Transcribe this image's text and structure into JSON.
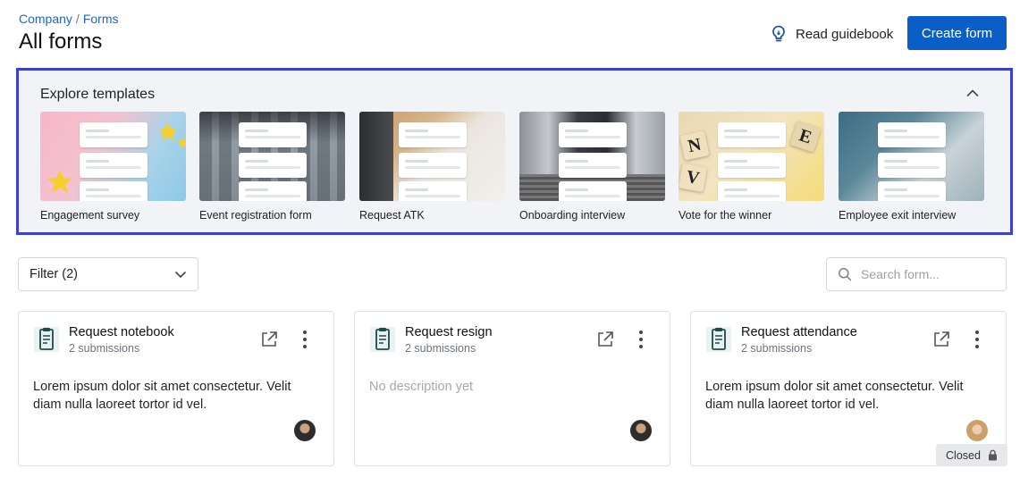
{
  "breadcrumb": {
    "items": [
      "Company",
      "Forms"
    ]
  },
  "header": {
    "title": "All forms",
    "guide_label": "Read guidebook",
    "create_label": "Create form"
  },
  "templates": {
    "title": "Explore templates",
    "items": [
      {
        "label": "Engagement survey"
      },
      {
        "label": "Event registration form"
      },
      {
        "label": "Request ATK"
      },
      {
        "label": "Onboarding interview"
      },
      {
        "label": "Vote for the winner"
      },
      {
        "label": "Employee exit interview"
      }
    ]
  },
  "toolbar": {
    "filter_label": "Filter (2)",
    "search_placeholder": "Search form..."
  },
  "forms": [
    {
      "title": "Request notebook",
      "submissions": "2 submissions",
      "description": "Lorem ipsum dolor sit amet consectetur. Velit diam nulla laoreet tortor id vel."
    },
    {
      "title": "Request resign",
      "submissions": "2 submissions",
      "description": "No description yet"
    },
    {
      "title": "Request attendance",
      "submissions": "2 submissions",
      "description": "Lorem ipsum dolor sit amet consectetur. Velit diam nulla laoreet tortor id vel.",
      "status": "Closed"
    }
  ],
  "colors": {
    "accent": "#0a5fc7",
    "link": "#1a66c9",
    "highlight_border": "#3b3fd4",
    "panel_bg": "#f1f3f7"
  },
  "icons": [
    "lightbulb-icon",
    "chevron-up-icon",
    "chevron-down-icon",
    "search-icon",
    "clipboard-icon",
    "external-link-icon",
    "more-vertical-icon",
    "lock-icon"
  ]
}
